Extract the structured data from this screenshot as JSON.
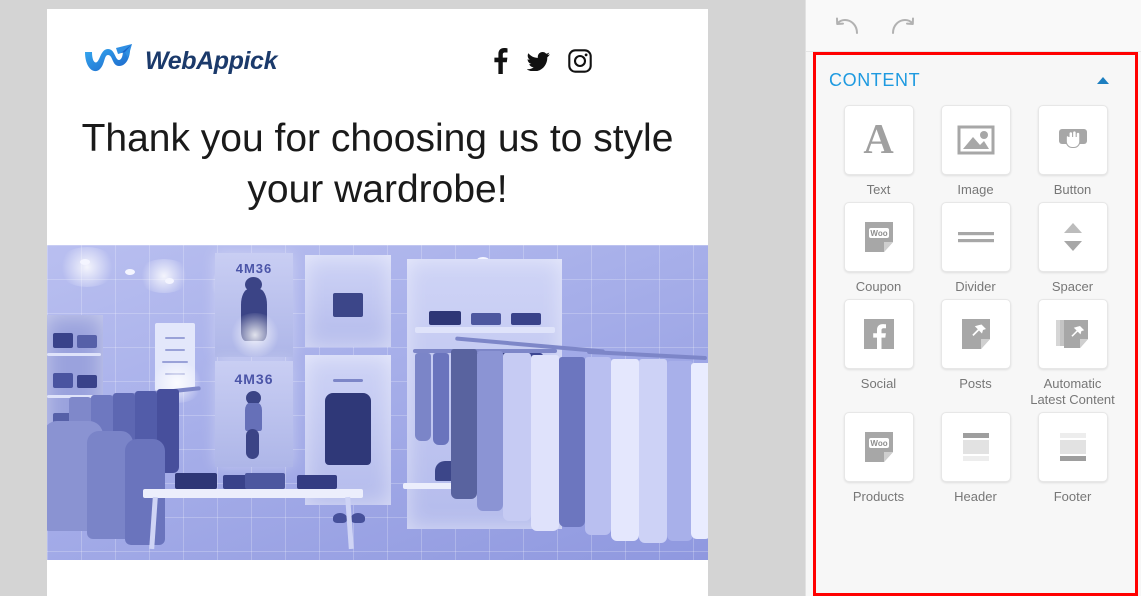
{
  "email": {
    "brand": {
      "name": "WebAppick",
      "mark_icon": "webappick-w-logo"
    },
    "social": [
      {
        "name": "facebook-icon",
        "label": "Facebook"
      },
      {
        "name": "twitter-icon",
        "label": "Twitter"
      },
      {
        "name": "instagram-icon",
        "label": "Instagram"
      }
    ],
    "headline": "Thank you for choosing us to style your wardrobe!",
    "photo": {
      "alt": "Clothing retail store interior with racks and display table",
      "poster_text_top": "4M36",
      "poster_text_bottom": "4M36",
      "duotone_color": "#8f98df"
    }
  },
  "sidebar": {
    "toolbar": [
      {
        "name": "undo-button",
        "label": "Undo"
      },
      {
        "name": "redo-button",
        "label": "Redo"
      }
    ],
    "panel": {
      "title": "CONTENT",
      "collapse_icon": "caret-up-icon",
      "highlight_color": "#ff0000",
      "accent_color": "#1e9ae0",
      "items": [
        {
          "label": "Text",
          "icon": "text-a-icon"
        },
        {
          "label": "Image",
          "icon": "image-icon"
        },
        {
          "label": "Button",
          "icon": "button-cursor-icon"
        },
        {
          "label": "Coupon",
          "icon": "woo-coupon-icon"
        },
        {
          "label": "Divider",
          "icon": "divider-icon"
        },
        {
          "label": "Spacer",
          "icon": "spacer-arrows-icon"
        },
        {
          "label": "Social",
          "icon": "facebook-square-icon"
        },
        {
          "label": "Posts",
          "icon": "pin-post-icon"
        },
        {
          "label": "Automatic Latest Content",
          "icon": "stacked-posts-icon"
        },
        {
          "label": "Products",
          "icon": "woo-products-icon"
        },
        {
          "label": "Header",
          "icon": "header-layout-icon"
        },
        {
          "label": "Footer",
          "icon": "footer-layout-icon"
        }
      ]
    }
  }
}
